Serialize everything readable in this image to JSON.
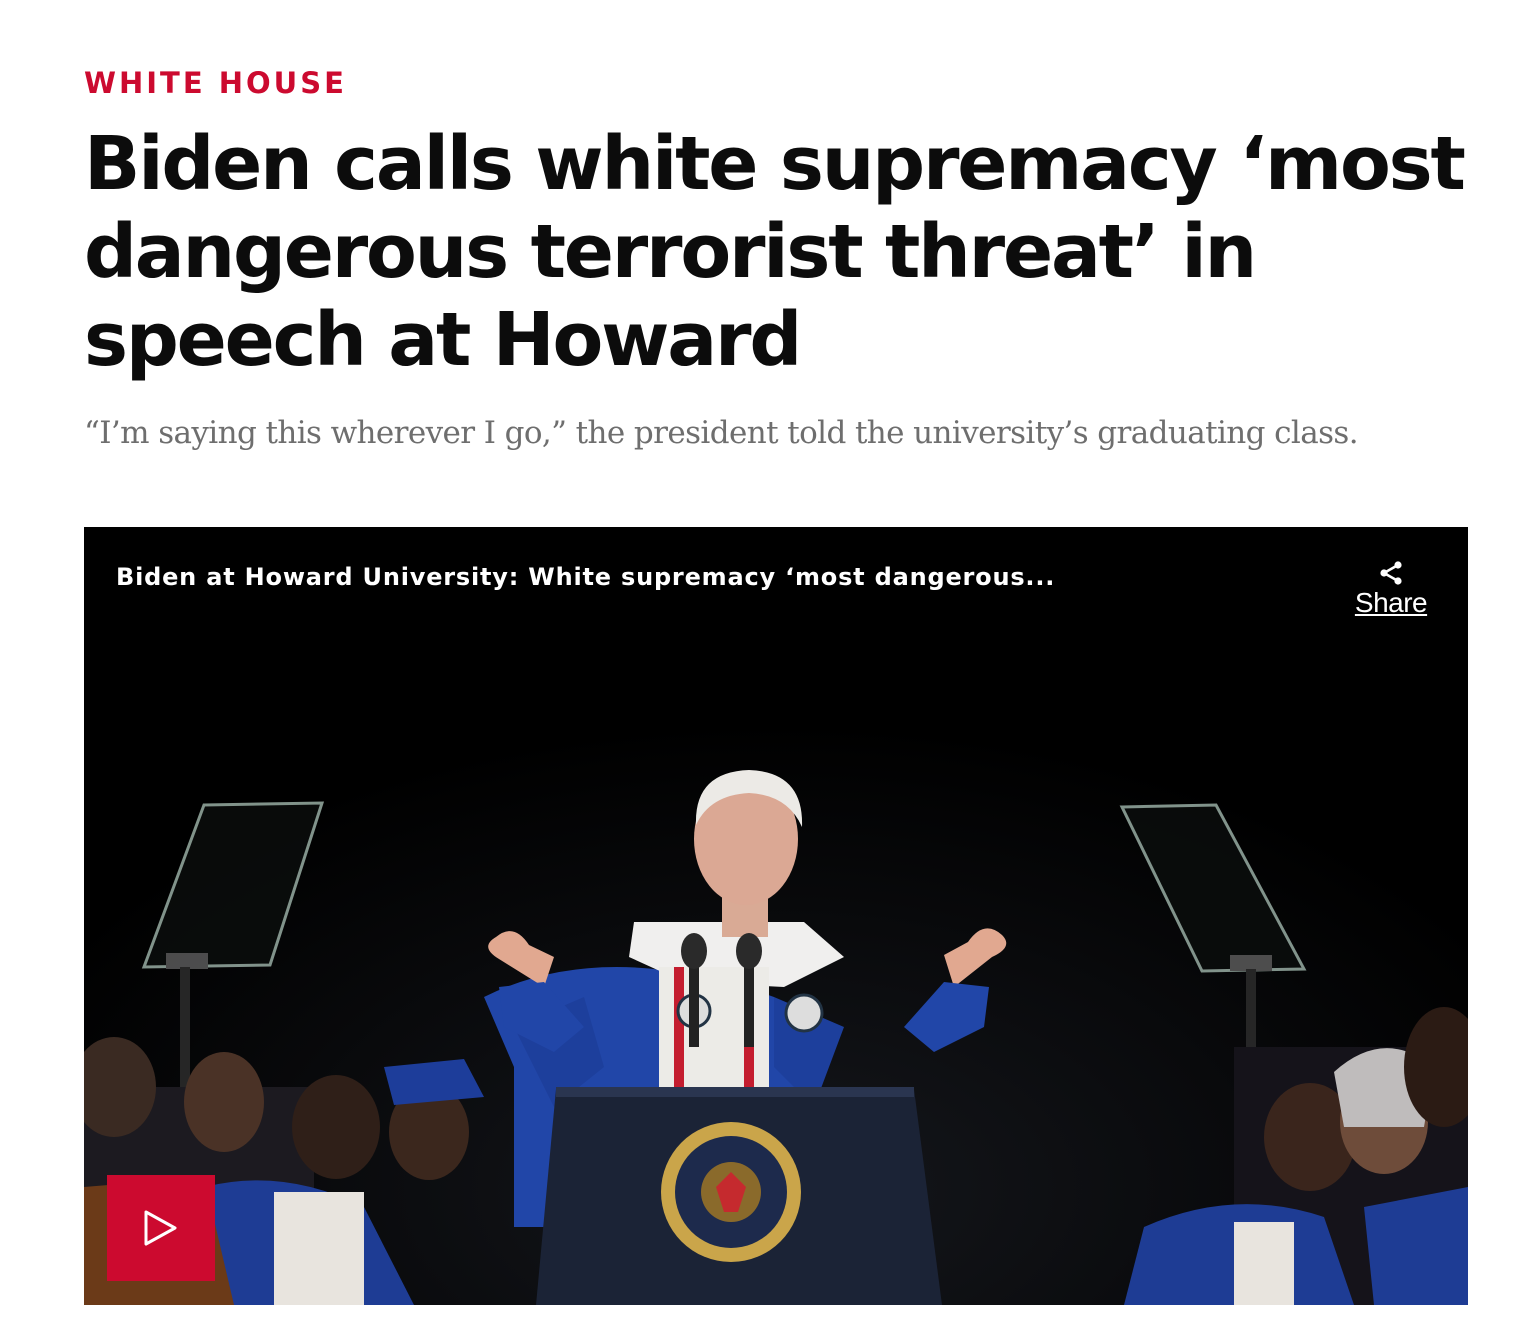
{
  "article": {
    "section": "WHITE HOUSE",
    "headline": "Biden calls white supremacy ‘most dangerous terrorist threat’ in speech at Howard",
    "dek": "“I’m saying this wherever I go,” the president told the university’s graduating class."
  },
  "video": {
    "title": "Biden at Howard University: White supremacy ‘most dangerous...",
    "share_label": "Share",
    "play_icon": "play-icon",
    "share_icon": "share-icon"
  },
  "colors": {
    "accent": "#cc0a2f",
    "headline": "#0c0c0c",
    "dek": "#6e6e6e",
    "player_bg": "#000000"
  }
}
